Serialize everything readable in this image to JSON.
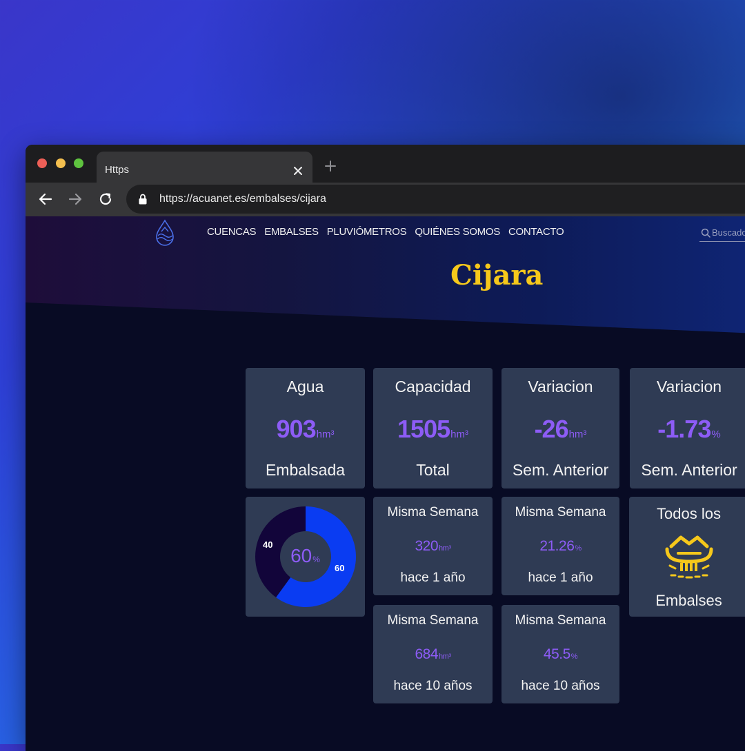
{
  "browser": {
    "tab_title": "Https",
    "url": "https://acuanet.es/embalses/cijara"
  },
  "nav": {
    "items": [
      "CUENCAS",
      "EMBALSES",
      "PLUVIÓMETROS",
      "QUIÉNES SOMOS",
      "CONTACTO"
    ],
    "search_placeholder": "Buscado"
  },
  "page_title": "Cijara",
  "stats": {
    "agua": {
      "top": "Agua",
      "value": "903",
      "unit": "hm³",
      "bottom": "Embalsada"
    },
    "capacidad": {
      "top": "Capacidad",
      "value": "1505",
      "unit": "hm³",
      "bottom": "Total"
    },
    "variacion_abs": {
      "top": "Variacion",
      "value": "-26",
      "unit": "hm³",
      "bottom": "Sem. Anterior"
    },
    "variacion_pct": {
      "top": "Variacion",
      "value": "-1.73",
      "unit": "%",
      "bottom": "Sem. Anterior"
    }
  },
  "donut": {
    "center_value": "60",
    "center_unit": "%",
    "full_label": "60",
    "empty_label": "40",
    "fill_fraction": 0.6,
    "full_color": "#0a3cf2",
    "empty_color": "#12053a",
    "hole_color": "#2f3b54"
  },
  "comparisons": [
    {
      "top": "Misma Semana",
      "value": "320",
      "unit": "hm³",
      "bottom": "hace 1 año"
    },
    {
      "top": "Misma Semana",
      "value": "21.26",
      "unit": "%",
      "bottom": "hace 1 año"
    },
    {
      "top": "Misma Semana",
      "value": "684",
      "unit": "hm³",
      "bottom": "hace 10 años"
    },
    {
      "top": "Misma Semana",
      "value": "45.5",
      "unit": "%",
      "bottom": "hace 10 años"
    }
  ],
  "all_reservoirs": {
    "top": "Todos los",
    "bottom": "Embalses",
    "icon": "reservoir-dam-icon"
  },
  "colors": {
    "accent_value": "#8d5cf6",
    "title_yellow": "#f6c81b",
    "card_bg": "#2f3b54"
  }
}
